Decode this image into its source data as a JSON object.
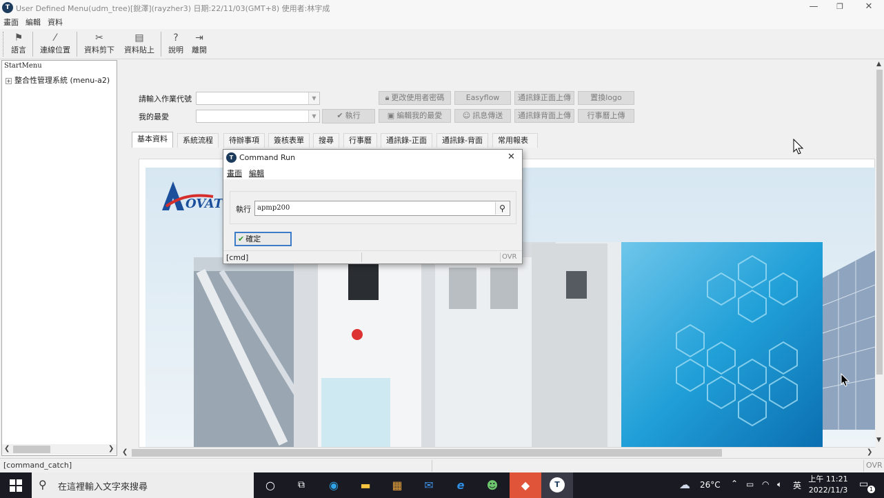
{
  "window": {
    "title": "User Defined Menu(udm_tree)[銳澤](rayzher3) 日期:22/11/03(GMT+8) 使用者:林宇成",
    "controls": [
      "minimize-icon",
      "restore-icon",
      "close-icon"
    ]
  },
  "menubar": [
    "畫面",
    "編輯",
    "資料"
  ],
  "toolbar": [
    {
      "label": "語言",
      "icon": "flag-icon"
    },
    {
      "label": "連線位置",
      "icon": "wand-icon"
    },
    {
      "label": "資料剪下",
      "icon": "scissors-icon"
    },
    {
      "label": "資料貼上",
      "icon": "clipboard-icon"
    },
    {
      "label": "說明",
      "icon": "help-icon"
    },
    {
      "label": "離開",
      "icon": "exit-icon"
    }
  ],
  "tree": {
    "root": "StartMenu",
    "items": [
      {
        "label": "整合性管理系統 (menu-a2)",
        "expander": "⊞"
      }
    ]
  },
  "form": {
    "job_code_label": "請輸入作業代號",
    "job_code_value": "",
    "favorite_label": "我的最愛",
    "favorite_value": "",
    "run_button": "執行",
    "buttons": [
      {
        "label": "更改使用者密碼",
        "icon": "lock-icon"
      },
      {
        "label": "Easyflow",
        "icon": ""
      },
      {
        "label": "通訊錄正面上傳",
        "icon": ""
      },
      {
        "label": "置換logo",
        "icon": ""
      },
      {
        "label": "編輯我的最愛",
        "icon": "edit-icon"
      },
      {
        "label": "訊息傳送",
        "icon": "smiley-icon"
      },
      {
        "label": "通訊錄背面上傳",
        "icon": ""
      },
      {
        "label": "行事曆上傳",
        "icon": ""
      }
    ]
  },
  "tabs": [
    "基本資料",
    "系統流程",
    "待辦事項",
    "簽核表單",
    "搜尋",
    "行事曆",
    "通訊錄-正面",
    "通訊錄-背面",
    "常用報表"
  ],
  "active_tab": 0,
  "banner": {
    "logo_text": "OVAT"
  },
  "dialog": {
    "title": "Command Run",
    "menu": [
      "畫面",
      "編輯"
    ],
    "run_label": "執行",
    "command_value": "apmp200",
    "ok_button": "確定",
    "status_left": "[cmd]",
    "status_right": "OVR"
  },
  "statusbar": {
    "left": "[command_catch]",
    "right": "OVR"
  },
  "taskbar": {
    "search_placeholder": "在這裡輸入文字來搜尋",
    "weather": "26°C",
    "ime": "英",
    "time": "上午 11:21",
    "date": "2022/11/3",
    "notification_count": "1"
  }
}
